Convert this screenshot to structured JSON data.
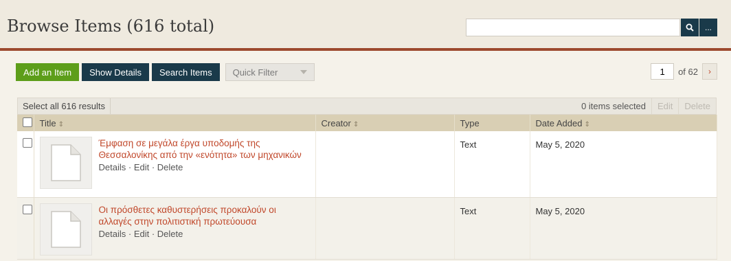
{
  "header": {
    "title": "Browse Items (616 total)",
    "search": {
      "value": "",
      "placeholder": ""
    },
    "search_icon": "search-icon",
    "advanced_label": "..."
  },
  "toolbar": {
    "add_item": "Add an Item",
    "show_details": "Show Details",
    "search_items": "Search Items",
    "quick_filter": "Quick Filter"
  },
  "pagination": {
    "current_page": "1",
    "of_label": "of 62",
    "next": "›"
  },
  "bulk": {
    "select_all": "Select all 616 results",
    "items_selected": "0 items selected",
    "edit": "Edit",
    "delete": "Delete"
  },
  "table": {
    "columns": {
      "title": "Title",
      "creator": "Creator",
      "type": "Type",
      "date_added": "Date Added"
    },
    "rows": [
      {
        "title": "Έμφαση σε μεγάλα έργα υποδομής της Θεσσαλονίκης από την «ενότητα» των μηχανικών",
        "details": "Details",
        "edit": "Edit",
        "delete": "Delete",
        "creator": "",
        "type": "Text",
        "date_added": "May 5, 2020"
      },
      {
        "title": "Οι πρόσθετες καθυστερήσεις προκαλούν οι αλλαγές στην πολιτιστική πρωτεύουσα",
        "details": "Details",
        "edit": "Edit",
        "delete": "Delete",
        "creator": "",
        "type": "Text",
        "date_added": "May 5, 2020"
      }
    ]
  },
  "colors": {
    "accent": "#c0472a",
    "dark_button": "#1a3a4a",
    "green_button": "#5d9e1a",
    "header_rule": "#9c4a2e"
  }
}
